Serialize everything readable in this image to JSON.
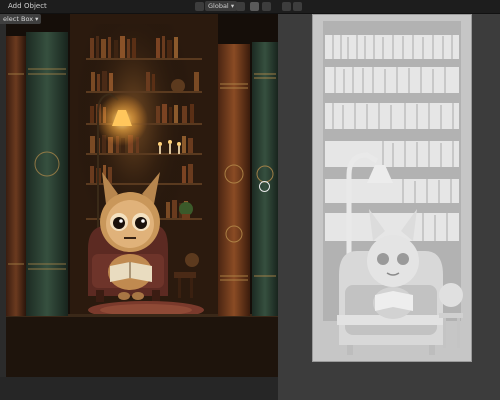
{
  "header": {
    "menu": [
      "Add",
      "Object"
    ],
    "transform_orientation": "Global"
  },
  "tool": {
    "active_tool_label": "elect Box"
  },
  "colors": {
    "ui_bg": "#2b2b2b",
    "header_bg": "#1d1d1d",
    "render_bg": "#160f0a",
    "lamp_glow": "#ffcf6a",
    "relief_gray": "#c9c9c9"
  }
}
